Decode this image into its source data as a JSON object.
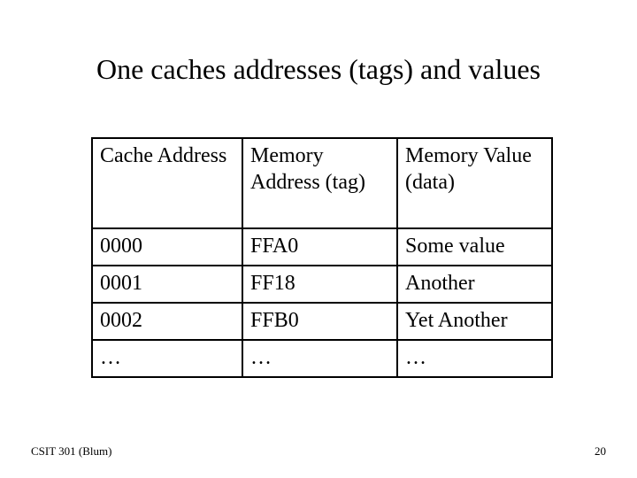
{
  "title": "One caches addresses (tags) and values",
  "table": {
    "headers": {
      "col0": "Cache Address",
      "col1": "Memory Address (tag)",
      "col2": "Memory Value (data)"
    },
    "rows": [
      {
        "col0": "0000",
        "col1": "FFA0",
        "col2": "Some value"
      },
      {
        "col0": "0001",
        "col1": "FF18",
        "col2": "Another"
      },
      {
        "col0": "0002",
        "col1": "FFB0",
        "col2": "Yet Another"
      },
      {
        "col0": "…",
        "col1": "…",
        "col2": "…"
      }
    ]
  },
  "footer": {
    "left": "CSIT 301 (Blum)",
    "right": "20"
  }
}
